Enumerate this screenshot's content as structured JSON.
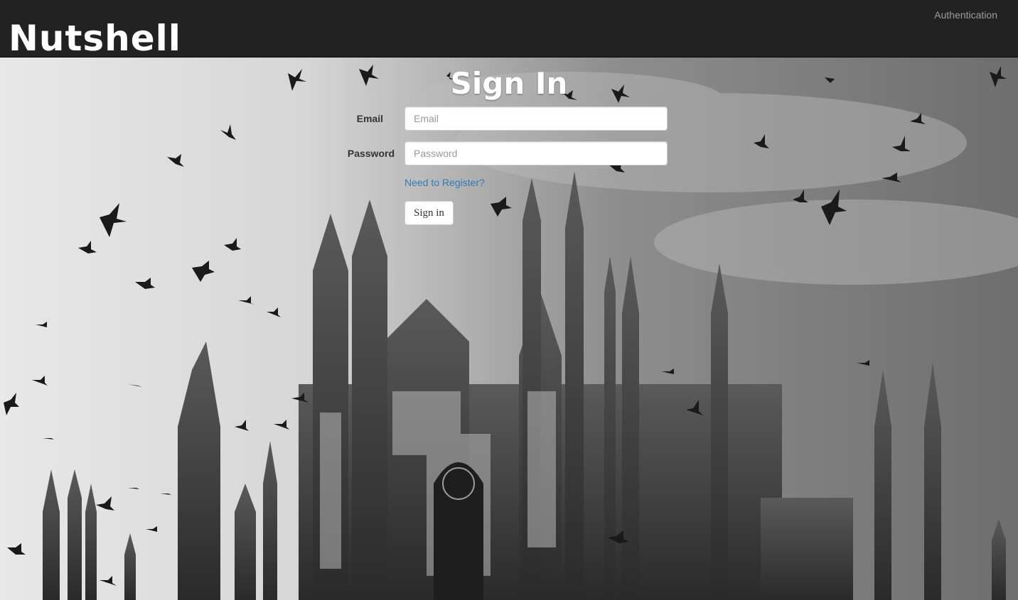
{
  "navbar": {
    "brand": "Nutshell",
    "auth_link": "Authentication"
  },
  "signin": {
    "title": "Sign In",
    "email_label": "Email",
    "email_placeholder": "Email",
    "email_value": "",
    "password_label": "Password",
    "password_placeholder": "Password",
    "password_value": "",
    "register_link": "Need to Register?",
    "submit_label": "Sign in"
  },
  "background": {
    "description_icon": "cathedral-with-pigeons-photo",
    "tone": "black-and-white"
  },
  "colors": {
    "navbar_bg": "#222222",
    "brand_text": "#ffffff",
    "nav_link_text": "#9d9d9d",
    "link_blue": "#337ab7"
  }
}
